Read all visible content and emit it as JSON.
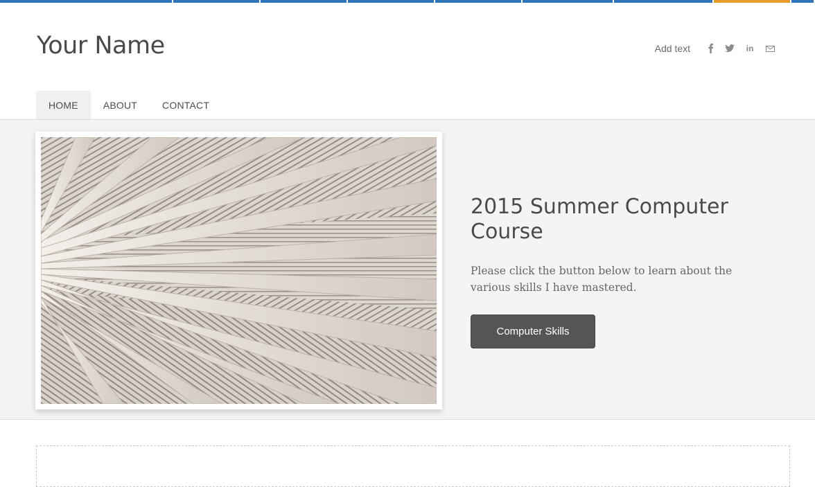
{
  "topbar": {
    "segments": [
      {
        "color": "#2f73b9",
        "w": 250
      },
      {
        "color": "#2f73b9",
        "w": 126
      },
      {
        "color": "#2f73b9",
        "w": 126
      },
      {
        "color": "#2f73b9",
        "w": 126
      },
      {
        "color": "#2f73b9",
        "w": 126
      },
      {
        "color": "#2f73b9",
        "w": 132
      },
      {
        "color": "#2f73b9",
        "w": 144
      },
      {
        "color": "#e89a2b",
        "w": 112
      },
      {
        "color": "#2f73b9",
        "w": 34
      }
    ]
  },
  "header": {
    "site_title": "Your Name",
    "add_text": "Add text",
    "social": [
      {
        "name": "facebook-icon",
        "glyph": "f"
      },
      {
        "name": "twitter-icon",
        "glyph": "𝕥"
      },
      {
        "name": "linkedin-icon",
        "glyph": "in"
      },
      {
        "name": "email-icon",
        "glyph": "✉"
      }
    ]
  },
  "nav": {
    "items": [
      {
        "label": "HOME",
        "active": true
      },
      {
        "label": "ABOUT",
        "active": false
      },
      {
        "label": "CONTACT",
        "active": false
      }
    ]
  },
  "hero": {
    "heading": "2015 Summer Computer Course",
    "text": "Please click the button below to learn about the various skills I have mastered.",
    "button_label": "Computer Skills"
  },
  "colors": {
    "accent": "#2f73b9",
    "accent_orange": "#e89a2b",
    "button_bg": "#555555",
    "hero_bg": "#f4f4f4"
  }
}
